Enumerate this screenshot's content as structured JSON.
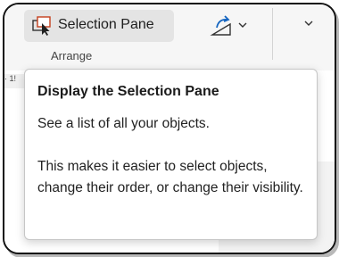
{
  "ribbon": {
    "selection_pane_label": "Selection Pane",
    "group_label": "Arrange",
    "selection_pane_icon": "selection-pane-icon",
    "rotate_icon": "rotate-icon"
  },
  "ruler": {
    "text": "· 1!"
  },
  "tooltip": {
    "title": "Display the Selection Pane",
    "line1": "See a list of all your objects.",
    "line2": "This makes it easier to select objects, change their order, or change their visibility."
  },
  "colors": {
    "accent": "#c43e1c",
    "tooltip_bg": "#ffffff",
    "ribbon_bg": "#f6f6f6"
  }
}
